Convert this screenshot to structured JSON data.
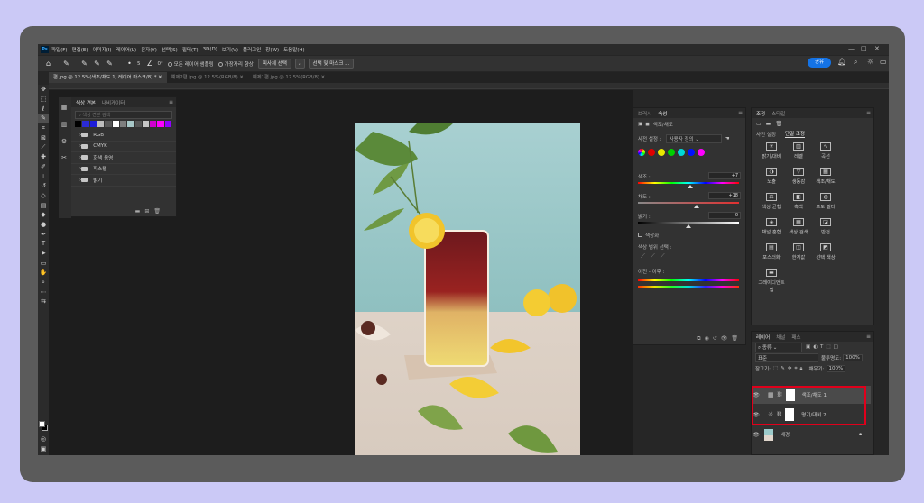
{
  "menubar": {
    "logo": "Ps",
    "items": [
      "파일(F)",
      "편집(E)",
      "이미지(I)",
      "레이어(L)",
      "문자(Y)",
      "선택(S)",
      "필터(T)",
      "3D(D)",
      "보기(V)",
      "플러그인",
      "창(W)",
      "도움말(H)"
    ]
  },
  "options": {
    "brush_size": "5",
    "angle": "0°",
    "sample_all": "모든 레이어 샘플링",
    "edge": "가장자리 향상",
    "subject_btn": "피사체 선택",
    "mask_btn": "선택 및 마스크 ...",
    "share": "공유"
  },
  "tabs": [
    "편.jpg @ 12.5%(색조/채도 1, 레이어 마스크/8) *",
    "예제2편.jpg @ 12.5%(RGB/8)",
    "예제1편.jpg @ 12.5%(RGB/8)"
  ],
  "swatches": {
    "tabs": [
      "색상 견본",
      "내비게이터"
    ],
    "search_placeholder": "색상 견본 검색",
    "colors": [
      "#000000",
      "#2b2bd5",
      "#1c1cd9",
      "#bdbdbd",
      "#575757",
      "#ffffff",
      "#7e7e7e",
      "#a8c8c8",
      "#555555",
      "#c7c7c7",
      "#d000d0",
      "#ff00ff",
      "#9000ff"
    ],
    "folders": [
      "RGB",
      "CMYK",
      "회색 음영",
      "파스텔",
      "밝기"
    ]
  },
  "properties": {
    "tabs": [
      "브러시",
      "속성"
    ],
    "title": "색조/채도",
    "preset_label": "사전 설정 :",
    "preset_value": "사용자 정의",
    "hue_label": "색조 :",
    "hue_value": "+7",
    "sat_label": "채도 :",
    "sat_value": "+18",
    "light_label": "밝기 :",
    "light_value": "0",
    "colorize": "색상화",
    "range_label": "색상 범위 선택 :",
    "before_after": "이전 - 이후 :",
    "colors": [
      "#e00000",
      "#e8e800",
      "#00d000",
      "#00d8d8",
      "#0010ff",
      "#ff00ff"
    ]
  },
  "adjustments": {
    "tabs": [
      "조정",
      "스타일"
    ],
    "sub_tabs": [
      "사전 설정",
      "단일 조정"
    ],
    "items": [
      "밝기/대비",
      "레벨",
      "곡선",
      "노출",
      "생동감",
      "색조/채도",
      "색상 균형",
      "흑백",
      "포토 필터",
      "채널 혼합",
      "색상 검색",
      "반전",
      "포스터화",
      "한계값",
      "선택 색상",
      "그레이디언트 맵"
    ]
  },
  "layers": {
    "tabs": [
      "레이어",
      "채널",
      "패스"
    ],
    "filter": "종류",
    "blend": "표준",
    "opacity_label": "불투명도:",
    "opacity": "100%",
    "lock_label": "잠그기:",
    "fill_label": "채우기:",
    "fill": "100%",
    "items": [
      "색조/채도 1",
      "명기/대비 2",
      "배경"
    ]
  }
}
